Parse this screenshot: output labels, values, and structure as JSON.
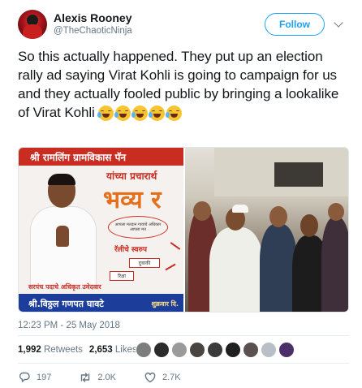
{
  "user": {
    "display_name": "Alexis Rooney",
    "handle": "@TheChaoticNinja",
    "avatar_icon": "avatar-red-icon"
  },
  "follow_label": "Follow",
  "tweet": {
    "text": "So this actually happened. They put up an election rally ad saying Virat Kohli is going to campaign for us and they actually fooled public by bringing a lookalike of Virat Kohli",
    "emoji_icons": [
      "face-with-tears-of-joy-icon",
      "face-with-tears-of-joy-icon",
      "face-with-tears-of-joy-icon",
      "face-with-tears-of-joy-icon",
      "face-with-tears-of-joy-icon"
    ]
  },
  "media": {
    "poster": {
      "banner": "श्री रामलिंग ग्रामविकास पॅन",
      "subtitle": "यांच्या प्रचारार्थ",
      "big_text": "भव्य र",
      "bubble": "आपला मतदान गावाचे अधिकार आपला मत",
      "tag": "रॅलीचे स्वरुप",
      "box1": "दुचाकी",
      "box2": "रिक्षा",
      "footer_line1": "सरपंच पदाचे अधिकृत उमेदवार",
      "footer_line2": "श्री.विठ्ठल गणपत घावटे",
      "footer_right": "शुक्रवार दि."
    }
  },
  "timestamp": "12:23 PM - 25 May 2018",
  "stats": {
    "retweets_count": "1,992",
    "retweets_label": "Retweets",
    "likes_count": "2,653",
    "likes_label": "Likes"
  },
  "actions": {
    "reply_count": "197",
    "retweet_count": "2.0K",
    "like_count": "2.7K"
  },
  "colors": {
    "accent": "#1da1f2",
    "muted": "#657786",
    "text": "#14171a"
  }
}
